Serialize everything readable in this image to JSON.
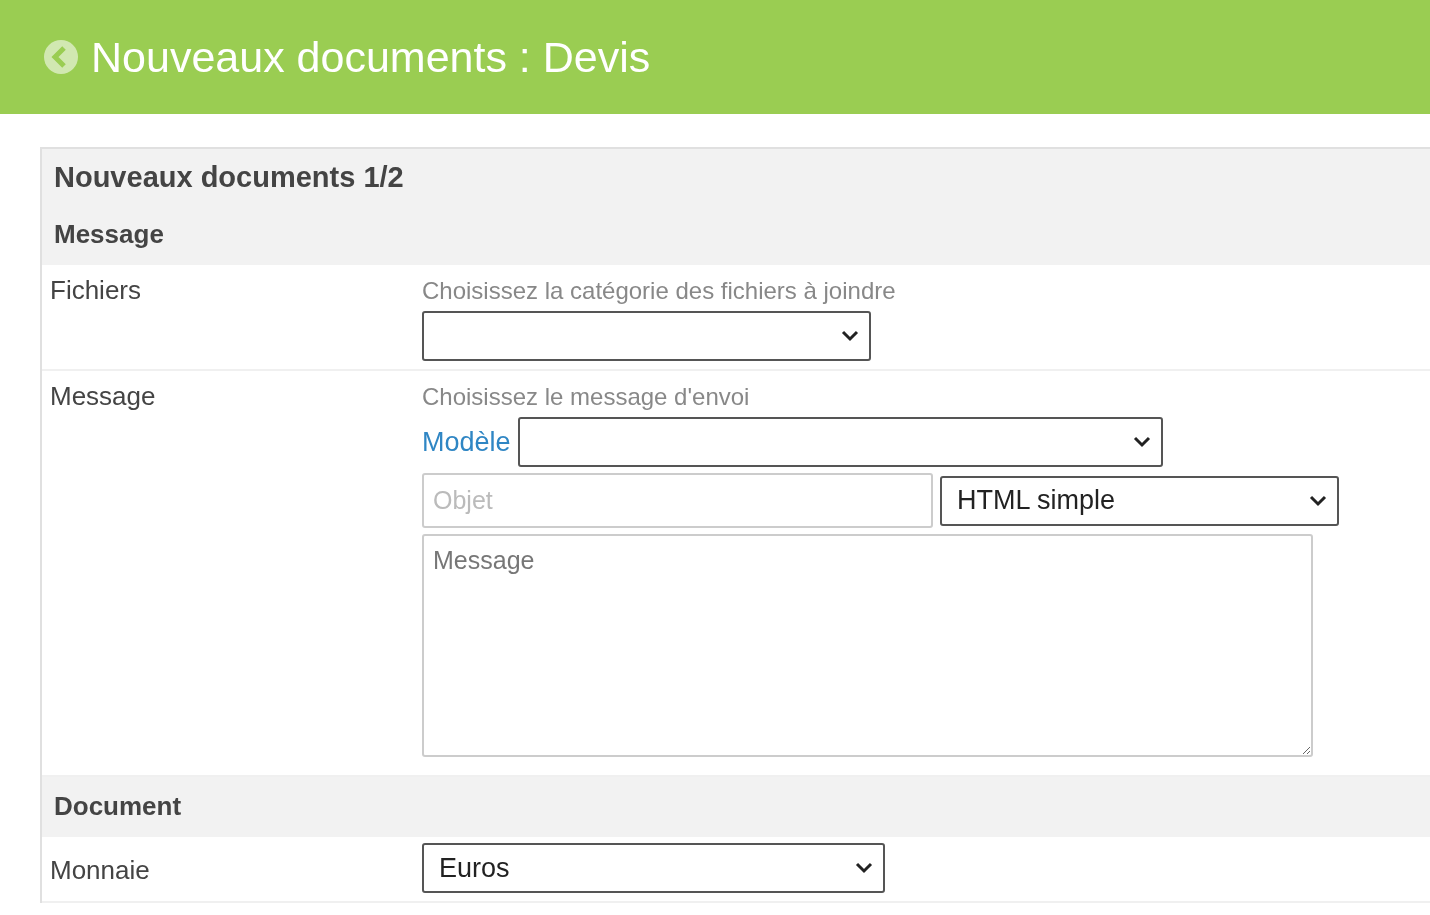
{
  "header": {
    "title": "Nouveaux documents : Devis"
  },
  "panel": {
    "title": "Nouveaux documents 1/2"
  },
  "message_section": {
    "heading": "Message",
    "files": {
      "label": "Fichiers",
      "hint": "Choisissez la catégorie des fichiers à joindre"
    },
    "message": {
      "label": "Message",
      "hint": "Choisissez le message d'envoi",
      "template_link": "Modèle",
      "subject": {
        "placeholder": "Objet"
      },
      "format": {
        "value": "HTML simple"
      },
      "body": {
        "placeholder": "Message"
      }
    }
  },
  "document_section": {
    "heading": "Document",
    "currency": {
      "label": "Monnaie",
      "value": "Euros"
    }
  }
}
